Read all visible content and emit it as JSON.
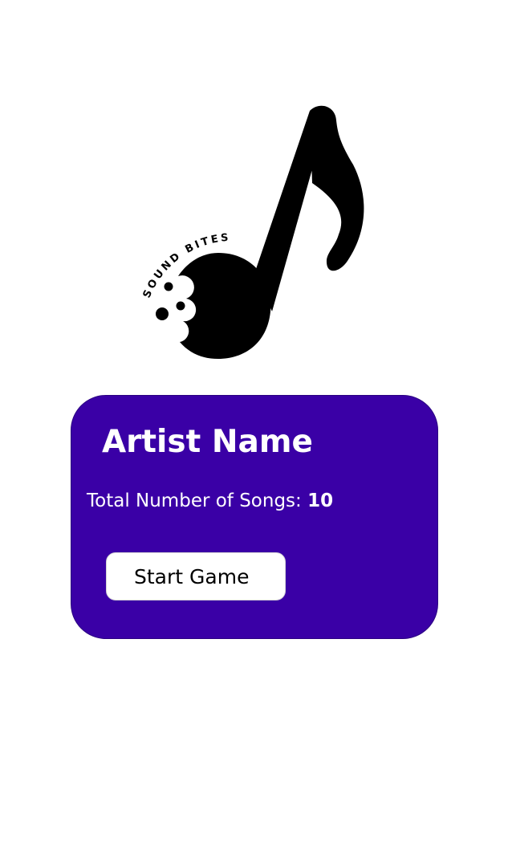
{
  "logo": {
    "text": "SOUND BITES",
    "icon": "bitten-music-note-icon",
    "color": "#000000"
  },
  "card": {
    "background_color": "#3a00a6",
    "artist_name": "Artist Name",
    "song_count_label": "Total Number of Songs: ",
    "song_count_value": "10",
    "start_button_label": "Start Game"
  }
}
